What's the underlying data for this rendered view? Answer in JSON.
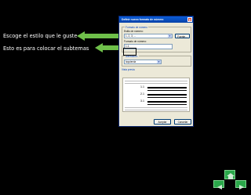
{
  "captions": [
    {
      "text": "Escoge el estilo que le guste"
    },
    {
      "text": "Esto es para colocar el subtemas"
    }
  ],
  "dialog": {
    "title": "Definir nuevo formato de número",
    "close_glyph": "x",
    "group_format_label": "Formato de número",
    "style_label": "Estilo de número:",
    "style_value": "1, 2, 3, ...",
    "font_button": "Fuente...",
    "format_label": "Formato de número:",
    "format_value": "1.1.",
    "align_group_label": "Alineación:",
    "align_value": "Izquierda",
    "preview_label": "Vista previa",
    "preview_numbers": [
      "1.1",
      "2.1",
      "3.1"
    ],
    "ok_button": "Aceptar",
    "cancel_button": "Cancelar"
  },
  "colors": {
    "arrow": "#6fc04a",
    "nav_green": "#2aa84a"
  }
}
